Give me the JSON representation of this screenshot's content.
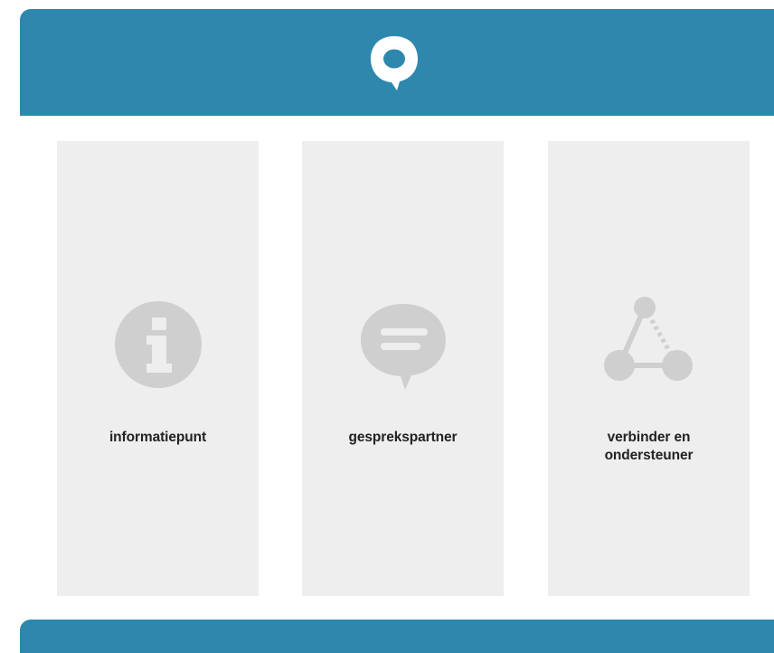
{
  "header": {
    "logo_icon": "speech-bubble-logo-icon",
    "color": "#2e88ae"
  },
  "cards": [
    {
      "icon": "info-icon",
      "label_lines": [
        "informatiepunt"
      ]
    },
    {
      "icon": "chat-bubble-icon",
      "label_lines": [
        "gesprekspartner"
      ]
    },
    {
      "icon": "network-connector-icon",
      "label_lines": [
        "verbinder en",
        "ondersteuner"
      ]
    }
  ],
  "colors": {
    "brand": "#2e88ae",
    "card_bg": "#eeeeee",
    "icon_gray": "#cfcfcf",
    "text": "#222222"
  }
}
